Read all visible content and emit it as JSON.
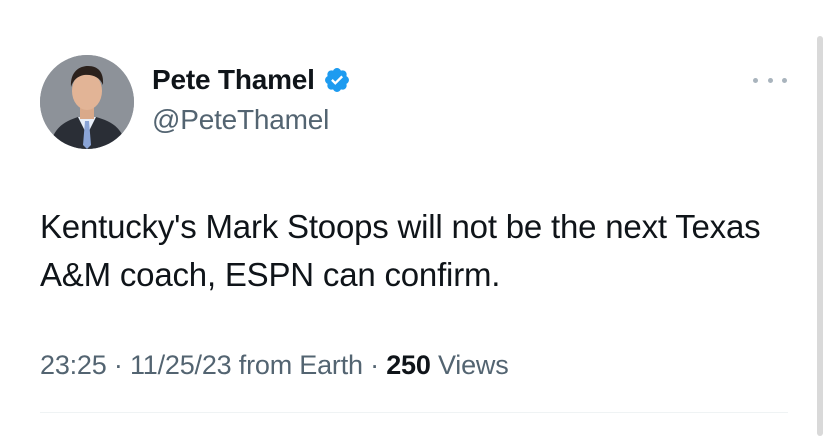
{
  "author": {
    "display_name": "Pete Thamel",
    "handle": "@PeteThamel",
    "verified": true
  },
  "icons": {
    "verified": "verified-badge-icon",
    "more": "more-options-icon"
  },
  "tweet": {
    "text": "Kentucky's Mark Stoops will not be the next Texas A&M coach, ESPN can confirm."
  },
  "meta": {
    "time": "23:25",
    "separator1": " · ",
    "date": "11/25/23",
    "source": " from Earth",
    "separator2": " · ",
    "views_count": "250",
    "views_label": " Views"
  },
  "colors": {
    "text": "#0f1419",
    "secondary": "#536471",
    "verified": "#1d9bf0",
    "divider": "#eff3f4"
  }
}
